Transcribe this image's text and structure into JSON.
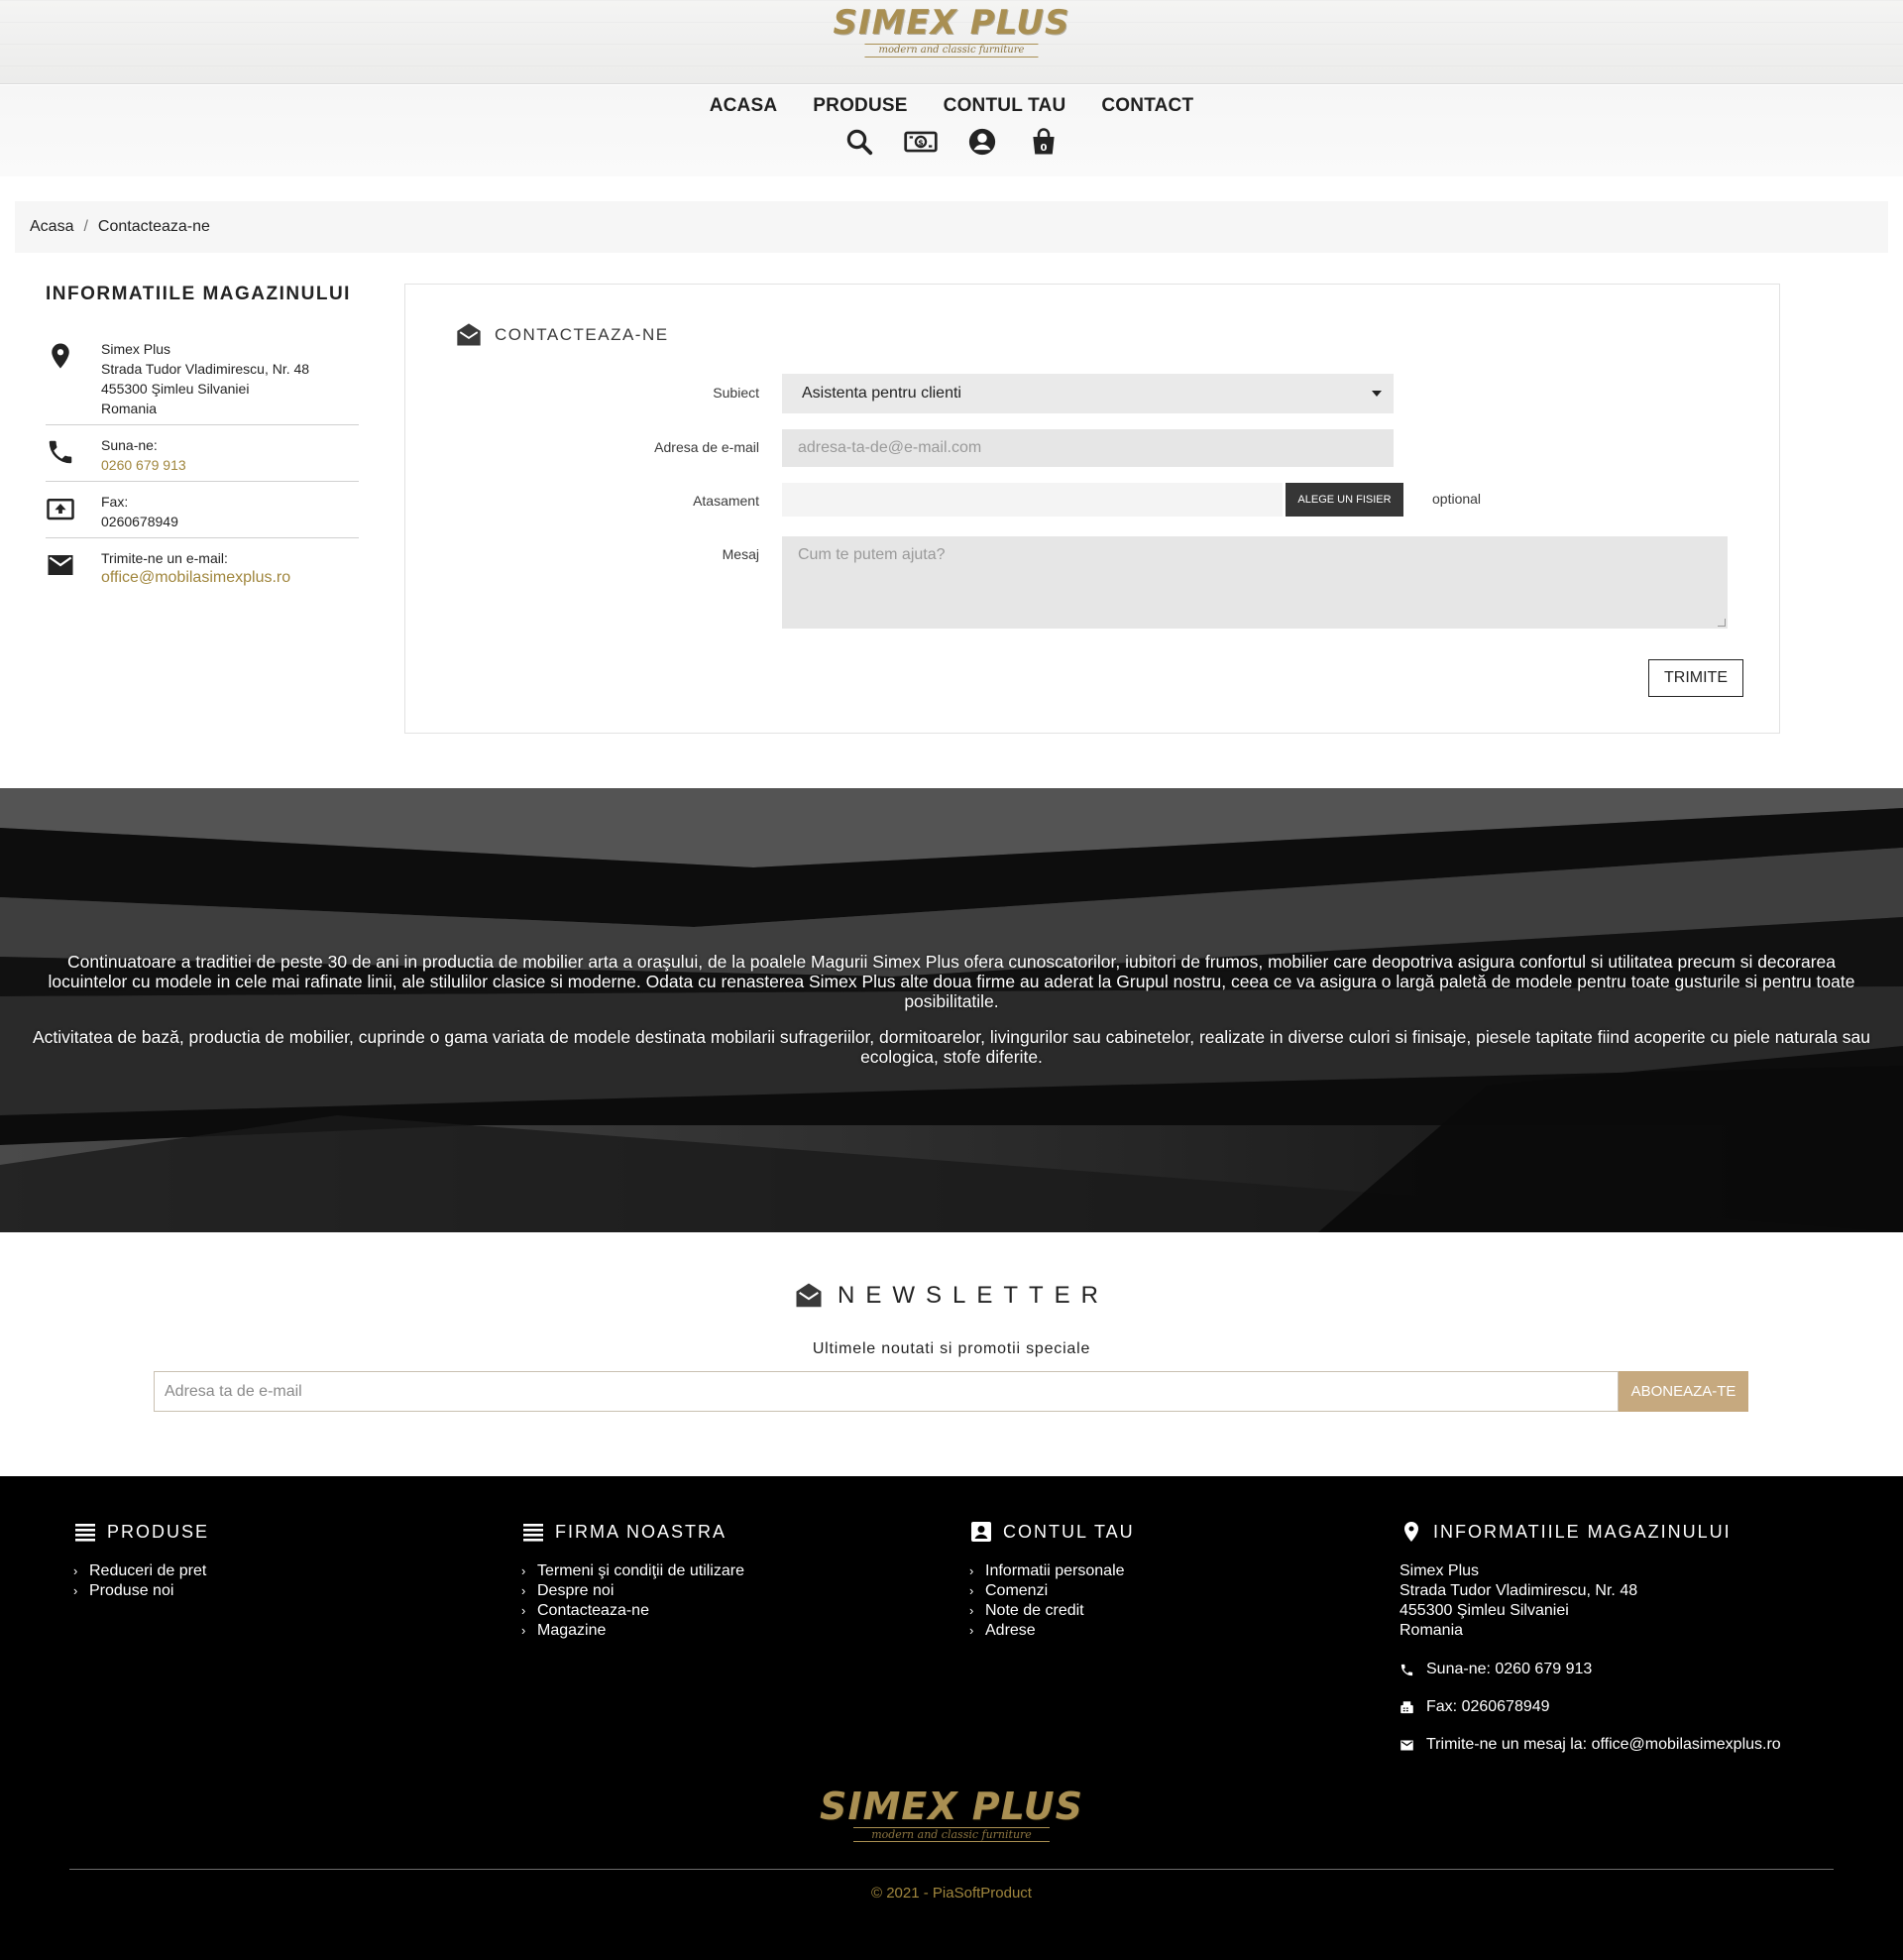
{
  "brand": {
    "logo_text": "SIMEX PLUS",
    "logo_tagline": "modern and classic furniture",
    "accent_color": "#a98f52"
  },
  "nav": {
    "items": [
      "ACASA",
      "PRODUSE",
      "CONTUL TAU",
      "CONTACT"
    ],
    "icons": [
      "search-icon",
      "currency-icon",
      "account-icon",
      "cart-icon"
    ]
  },
  "breadcrumb": {
    "home": "Acasa",
    "separator": "/",
    "current": "Contacteaza-ne"
  },
  "store_info": {
    "title": "INFORMATIILE MAGAZINULUI",
    "address": {
      "name": "Simex Plus",
      "street": "Strada Tudor Vladimirescu, Nr. 48",
      "city": "455300 Şimleu Silvaniei",
      "country": "Romania"
    },
    "phone": {
      "label": "Suna-ne:",
      "value": "0260 679 913"
    },
    "fax": {
      "label": "Fax:",
      "value": "0260678949"
    },
    "email": {
      "label": "Trimite-ne un e-mail:",
      "value": "office@mobilasimexplus.ro"
    }
  },
  "contact_form": {
    "title": "CONTACTEAZA-NE",
    "subject_label": "Subiect",
    "subject_value": "Asistenta pentru clienti",
    "email_label": "Adresa de e-mail",
    "email_placeholder": "adresa-ta-de@e-mail.com",
    "attachment_label": "Atasament",
    "file_button": "ALEGE UN FISIER",
    "optional": "optional",
    "message_label": "Mesaj",
    "message_placeholder": "Cum te putem ajuta?",
    "submit": "TRIMITE"
  },
  "banner": {
    "paragraph1": "Continuatoare a traditiei de peste 30 de ani in productia de mobilier arta a oraşului, de la poalele Magurii Simex Plus ofera cunoscatorilor, iubitori de frumos, mobilier care deopotriva asigura confortul si utilitatea precum si decorarea locuintelor cu modele in cele mai rafinate linii, ale stilulilor clasice si moderne. Odata cu renasterea Simex Plus alte doua firme au aderat la Grupul nostru, ceea ce va asigura o largă paletă de modele pentru toate gusturile si pentru toate posibilitatile.",
    "paragraph2": "Activitatea de bază, productia de mobilier, cuprinde o gama variata de modele destinata mobilarii sufrageriilor, dormitoarelor, livingurilor sau cabinetelor, realizate in diverse culori si finisaje, piesele tapitate fiind acoperite cu piele naturala sau ecologica, stofe diferite."
  },
  "newsletter": {
    "title": "NEWSLETTER",
    "subtitle": "Ultimele noutati si promotii speciale",
    "placeholder": "Adresa ta de e-mail",
    "button": "ABONEAZA-TE",
    "button_color": "#c6a97f"
  },
  "footer": {
    "produse": {
      "title": "PRODUSE",
      "items": [
        "Reduceri de pret",
        "Produse noi"
      ]
    },
    "firma": {
      "title": "FIRMA NOASTRA",
      "items": [
        "Termeni şi condiţii de utilizare",
        "Despre noi",
        "Contacteaza-ne",
        "Magazine"
      ]
    },
    "cont": {
      "title": "CONTUL TAU",
      "items": [
        "Informatii personale",
        "Comenzi",
        "Note de credit",
        "Adrese"
      ]
    },
    "info": {
      "title": "INFORMATIILE MAGAZINULUI",
      "name": "Simex Plus",
      "street": "Strada Tudor Vladimirescu, Nr. 48",
      "city": "455300 Şimleu Silvaniei",
      "country": "Romania",
      "phone": "Suna-ne: 0260 679 913",
      "fax": "Fax: 0260678949",
      "email": "Trimite-ne un mesaj la: office@mobilasimexplus.ro"
    },
    "copyright": "© 2021 - PiaSoftProduct"
  }
}
